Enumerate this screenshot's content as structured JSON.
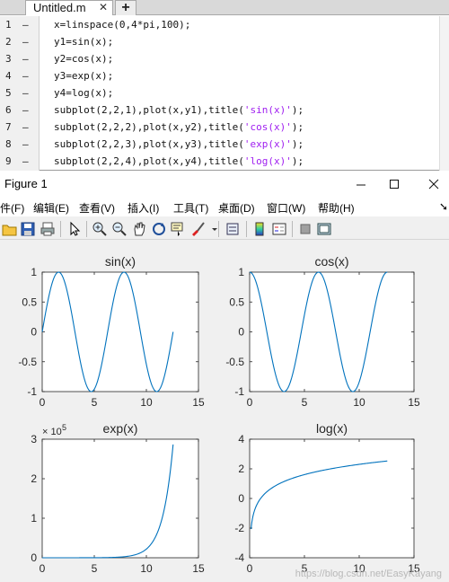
{
  "editor": {
    "tab_title": "Untitled.m",
    "tab_close": "✕",
    "tab_add": "+",
    "lines": [
      {
        "num": "1",
        "text": "x=linspace(0,4*pi,100);",
        "str": ""
      },
      {
        "num": "2",
        "text": "y1=sin(x);",
        "str": ""
      },
      {
        "num": "3",
        "text": "y2=cos(x);",
        "str": ""
      },
      {
        "num": "4",
        "text": "y3=exp(x);",
        "str": ""
      },
      {
        "num": "5",
        "text": "y4=log(x);",
        "str": ""
      },
      {
        "num": "6",
        "text": "subplot(2,2,1),plot(x,y1),title(",
        "str": "'sin(x)'",
        "end": ");"
      },
      {
        "num": "7",
        "text": "subplot(2,2,2),plot(x,y2),title(",
        "str": "'cos(x)'",
        "end": ");"
      },
      {
        "num": "8",
        "text": "subplot(2,2,3),plot(x,y3),title(",
        "str": "'exp(x)'",
        "end": ");"
      },
      {
        "num": "9",
        "text": "subplot(2,2,4),plot(x,y4),title(",
        "str": "'log(x)'",
        "end": ");"
      }
    ],
    "string_color": "#a020f0"
  },
  "figure": {
    "window_title": "Figure 1",
    "menus": [
      "件(F)",
      "编辑(E)",
      "查看(V)",
      "插入(I)",
      "工具(T)",
      "桌面(D)",
      "窗口(W)",
      "帮助(H)"
    ],
    "toolbar_icons": [
      "open-icon",
      "save-icon",
      "print-icon",
      "pointer-icon",
      "zoom-in-icon",
      "zoom-out-icon",
      "pan-icon",
      "rotate-icon",
      "data-cursor-icon",
      "brush-icon",
      "link-icon",
      "colorbar-icon",
      "legend-icon",
      "hide-tools-icon",
      "show-tools-icon"
    ],
    "watermark": "https://blog.csdn.net/EasyKayang",
    "line_color": "#0072bd"
  },
  "chart_data": [
    {
      "type": "line",
      "title": "sin(x)",
      "xlim": [
        0,
        15
      ],
      "ylim": [
        -1,
        1
      ],
      "xticks": [
        "0",
        "5",
        "10",
        "15"
      ],
      "yticks": [
        "1",
        "0.5",
        "0",
        "-0.5",
        "-1"
      ],
      "x_range": [
        0,
        12.566
      ],
      "function": "sin",
      "series": [
        {
          "points": 100
        }
      ]
    },
    {
      "type": "line",
      "title": "cos(x)",
      "xlim": [
        0,
        15
      ],
      "ylim": [
        -1,
        1
      ],
      "xticks": [
        "0",
        "5",
        "10",
        "15"
      ],
      "yticks": [
        "1",
        "0.5",
        "0",
        "-0.5",
        "-1"
      ],
      "x_range": [
        0,
        12.566
      ],
      "function": "cos",
      "series": [
        {
          "points": 100
        }
      ]
    },
    {
      "type": "line",
      "title": "exp(x)",
      "xlim": [
        0,
        15
      ],
      "ylim": [
        0,
        300000
      ],
      "xticks": [
        "0",
        "5",
        "10",
        "15"
      ],
      "yticks": [
        "3",
        "2",
        "1",
        "0"
      ],
      "exponent_label": "× 10",
      "exponent": "5",
      "x_range": [
        0,
        12.566
      ],
      "function": "exp",
      "series": [
        {
          "points": 100
        }
      ]
    },
    {
      "type": "line",
      "title": "log(x)",
      "xlim": [
        0,
        15
      ],
      "ylim": [
        -4,
        4
      ],
      "xticks": [
        "0",
        "5",
        "10",
        "15"
      ],
      "yticks": [
        "4",
        "2",
        "0",
        "-2",
        "-4"
      ],
      "x_range": [
        0.127,
        12.566
      ],
      "function": "log",
      "series": [
        {
          "points": 99
        }
      ]
    }
  ]
}
